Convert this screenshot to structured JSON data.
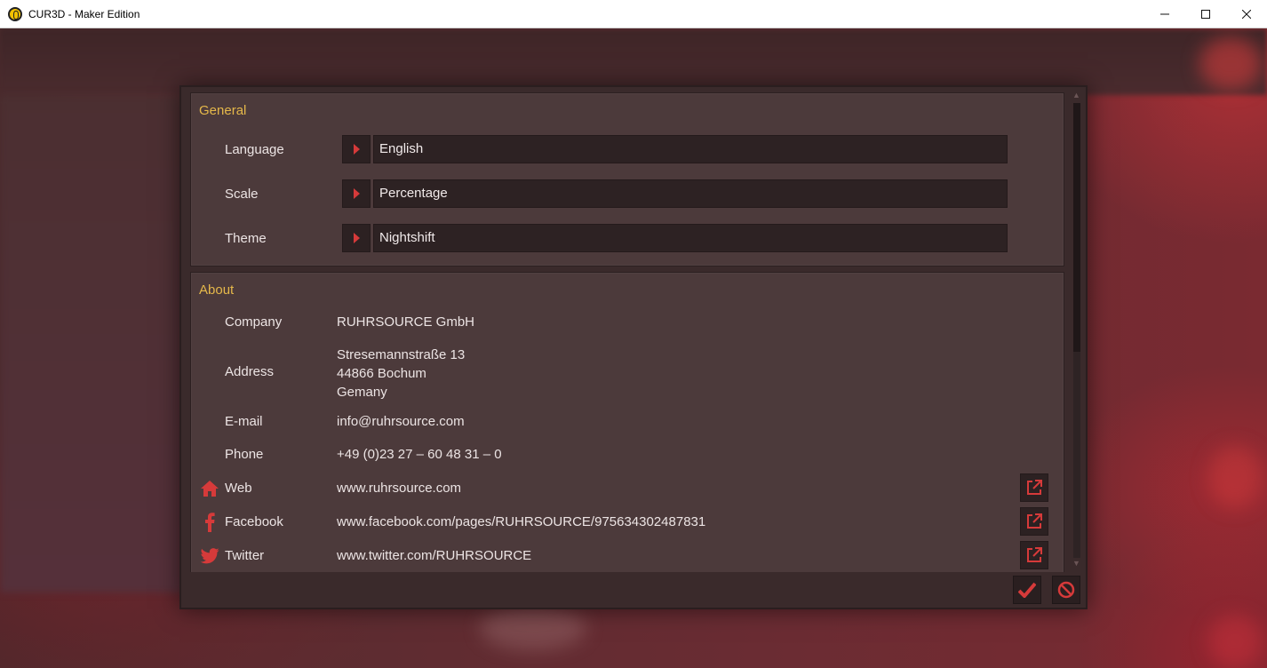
{
  "window": {
    "title": "CUR3D - Maker Edition",
    "controls": [
      "minimize",
      "maximize",
      "close"
    ]
  },
  "settings": {
    "general": {
      "title": "General",
      "rows": [
        {
          "label": "Language",
          "value": "English"
        },
        {
          "label": "Scale",
          "value": "Percentage"
        },
        {
          "label": "Theme",
          "value": "Nightshift"
        }
      ]
    },
    "about": {
      "title": "About",
      "company_label": "Company",
      "company_value": "RUHRSOURCE GmbH",
      "address_label": "Address",
      "address_lines": [
        "Stresemannstraße 13",
        "44866 Bochum",
        "Gemany"
      ],
      "email_label": "E-mail",
      "email_value": "info@ruhrsource.com",
      "phone_label": "Phone",
      "phone_value": "+49 (0)23 27 – 60 48 31 – 0",
      "links": [
        {
          "label": "Web",
          "value": "www.ruhrsource.com",
          "icon": "home-icon"
        },
        {
          "label": "Facebook",
          "value": "www.facebook.com/pages/RUHRSOURCE/975634302487831",
          "icon": "facebook-icon"
        },
        {
          "label": "Twitter",
          "value": "www.twitter.com/RUHRSOURCE",
          "icon": "twitter-icon"
        }
      ]
    }
  },
  "footer": {
    "confirm_icon": "checkmark-icon",
    "cancel_icon": "prohibited-icon"
  },
  "colors": {
    "accent_red": "#d63a3a",
    "section_title": "#e5b84a",
    "panel_bg": "#4c3a3b",
    "field_bg": "#2d2223"
  }
}
